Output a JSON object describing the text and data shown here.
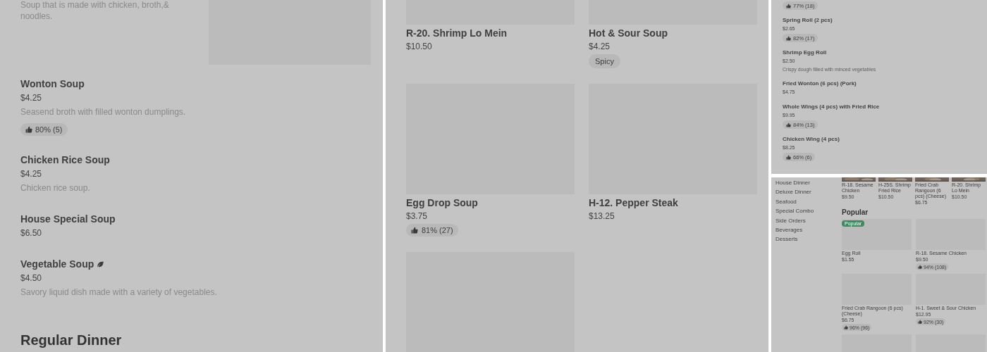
{
  "soup_list": {
    "top_item": {
      "description": "Soup that is made with chicken, broth,& noodles."
    },
    "items": [
      {
        "name": "Wonton Soup",
        "vegetarian": false,
        "price": "$4.25",
        "description": "Seasend broth with filled wonton dumplings.",
        "rating": "80% (5)"
      },
      {
        "name": "Chicken Rice Soup",
        "vegetarian": false,
        "price": "$4.25",
        "description": "Chicken rice soup."
      },
      {
        "name": "House Special Soup",
        "vegetarian": false,
        "price": "$6.50"
      },
      {
        "name": "Vegetable Soup",
        "vegetarian": true,
        "price": "$4.50",
        "description": "Savory liquid dish made with a variety of vegetables."
      }
    ],
    "next_section": "Regular Dinner"
  },
  "menu_grid": {
    "cards": [
      {
        "name": "R-20. Shrimp Lo Mein",
        "price": "$10.50"
      },
      {
        "name": "Hot & Sour Soup",
        "price": "$4.25",
        "tag": "Spicy"
      },
      {
        "name": "Egg Drop Soup",
        "price": "$3.75",
        "rating": "81% (27)"
      },
      {
        "name": "H-12.  Pepper Steak",
        "price": "$13.25"
      }
    ]
  },
  "compact_list": {
    "items": [
      {
        "rating": "77% (18)"
      },
      {
        "name": "Spring Roll (2 pcs)",
        "price": "$2.65",
        "rating": "82% (17)"
      },
      {
        "name": "Shrimp Egg Roll",
        "price": "$2.50",
        "description": "Crispy dough filled with minced vegetables"
      },
      {
        "name": "Fried Wonton (6 pcs) (Pork)",
        "price": "$4.75"
      },
      {
        "name": "Whole Wings (4 pcs) with Fried Rice",
        "price": "$9.95",
        "rating": "84% (13)"
      },
      {
        "name": "Chicken Wing (4 pcs)",
        "price": "$8.25",
        "rating": "66% (6)"
      }
    ]
  },
  "restaurant_page": {
    "categories": [
      "House Dinner",
      "Deluxe Dinner",
      "Seafood",
      "Special Combo",
      "Side Orders",
      "Beverages",
      "Desserts"
    ],
    "carousel": [
      {
        "name": "R-18. Sesame Chicken",
        "price": "$9.50"
      },
      {
        "name": "H-25S. Shrimp Fried Rice",
        "price": "$10.50"
      },
      {
        "name": "Fried Crab Rangoon (6 pcs) (Cheese)",
        "price": "$6.75"
      },
      {
        "name": "R-20. Shrimp Lo Mein",
        "price": "$10.50"
      }
    ],
    "popular": {
      "title": "Popular",
      "cards": [
        {
          "name": "Egg Roll",
          "price": "$1.55",
          "badge": "Popular"
        },
        {
          "name": "R-18. Sesame Chicken",
          "price": "$9.50",
          "rating": "94% (108)"
        },
        {
          "name": "Fried Crab Rangoon (6 pcs) (Cheese)",
          "price": "$6.75",
          "rating": "96% (96)"
        },
        {
          "name": "H-1. Sweet & Sour Chicken",
          "price": "$12.95",
          "rating": "92% (30)"
        }
      ]
    }
  }
}
